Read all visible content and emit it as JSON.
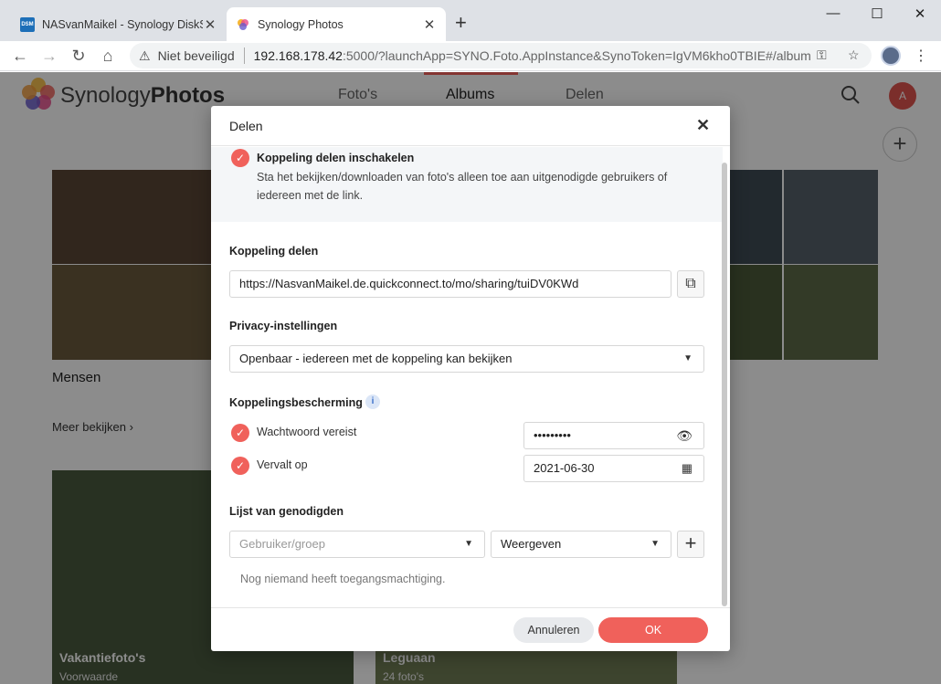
{
  "browser": {
    "tabs": [
      {
        "title": "NASvanMaikel - Synology DiskSt",
        "favicon_text": "DSM"
      },
      {
        "title": "Synology Photos"
      }
    ],
    "new_tab": "+",
    "window_controls": {
      "minimize": "—",
      "maximize": "☐",
      "close": "✕"
    },
    "nav": {
      "back": "←",
      "forward": "→",
      "reload": "↻",
      "home": "⌂"
    },
    "security_label": "Niet beveiligd",
    "url_host": "192.168.178.42",
    "url_rest": ":5000/?launchApp=SYNO.Foto.AppInstance&SynoToken=IgVM6kho0TBIE#/album"
  },
  "app": {
    "brand_light": "Synology",
    "brand_bold": "Photos",
    "nav": [
      {
        "label": "Foto's",
        "active": false
      },
      {
        "label": "Albums",
        "active": true
      },
      {
        "label": "Delen",
        "active": false
      }
    ],
    "avatar_initial": "A",
    "sections": {
      "people_title": "Mensen",
      "more_label": "Meer bekijken"
    },
    "albums": [
      {
        "title": "Vakantiefoto's",
        "sub": "Voorwaarde"
      },
      {
        "title": "Leguaan",
        "sub": "24 foto's"
      }
    ]
  },
  "dialog": {
    "title": "Delen",
    "enable": {
      "label": "Koppeling delen inschakelen",
      "description": "Sta het bekijken/downloaden van foto's alleen toe aan uitgenodigde gebruikers of iedereen met de link."
    },
    "link_section": "Koppeling delen",
    "link_url": "https://NasvanMaikel.de.quickconnect.to/mo/sharing/tuiDV0KWd",
    "privacy_section": "Privacy-instellingen",
    "privacy_value": "Openbaar - iedereen met de koppeling kan bekijken",
    "protection_section": "Koppelingsbescherming",
    "password_label": "Wachtwoord vereist",
    "password_value": "•••••••••",
    "expires_label": "Vervalt op",
    "expires_value": "2021-06-30",
    "invite_section": "Lijst van genodigden",
    "user_placeholder": "Gebruiker/groep",
    "permission_value": "Weergeven",
    "empty_text": "Nog niemand heeft toegangsmachtiging.",
    "cancel_label": "Annuleren",
    "ok_label": "OK"
  },
  "colors": {
    "accent": "#f0615b",
    "info": "#3a6fc9"
  }
}
